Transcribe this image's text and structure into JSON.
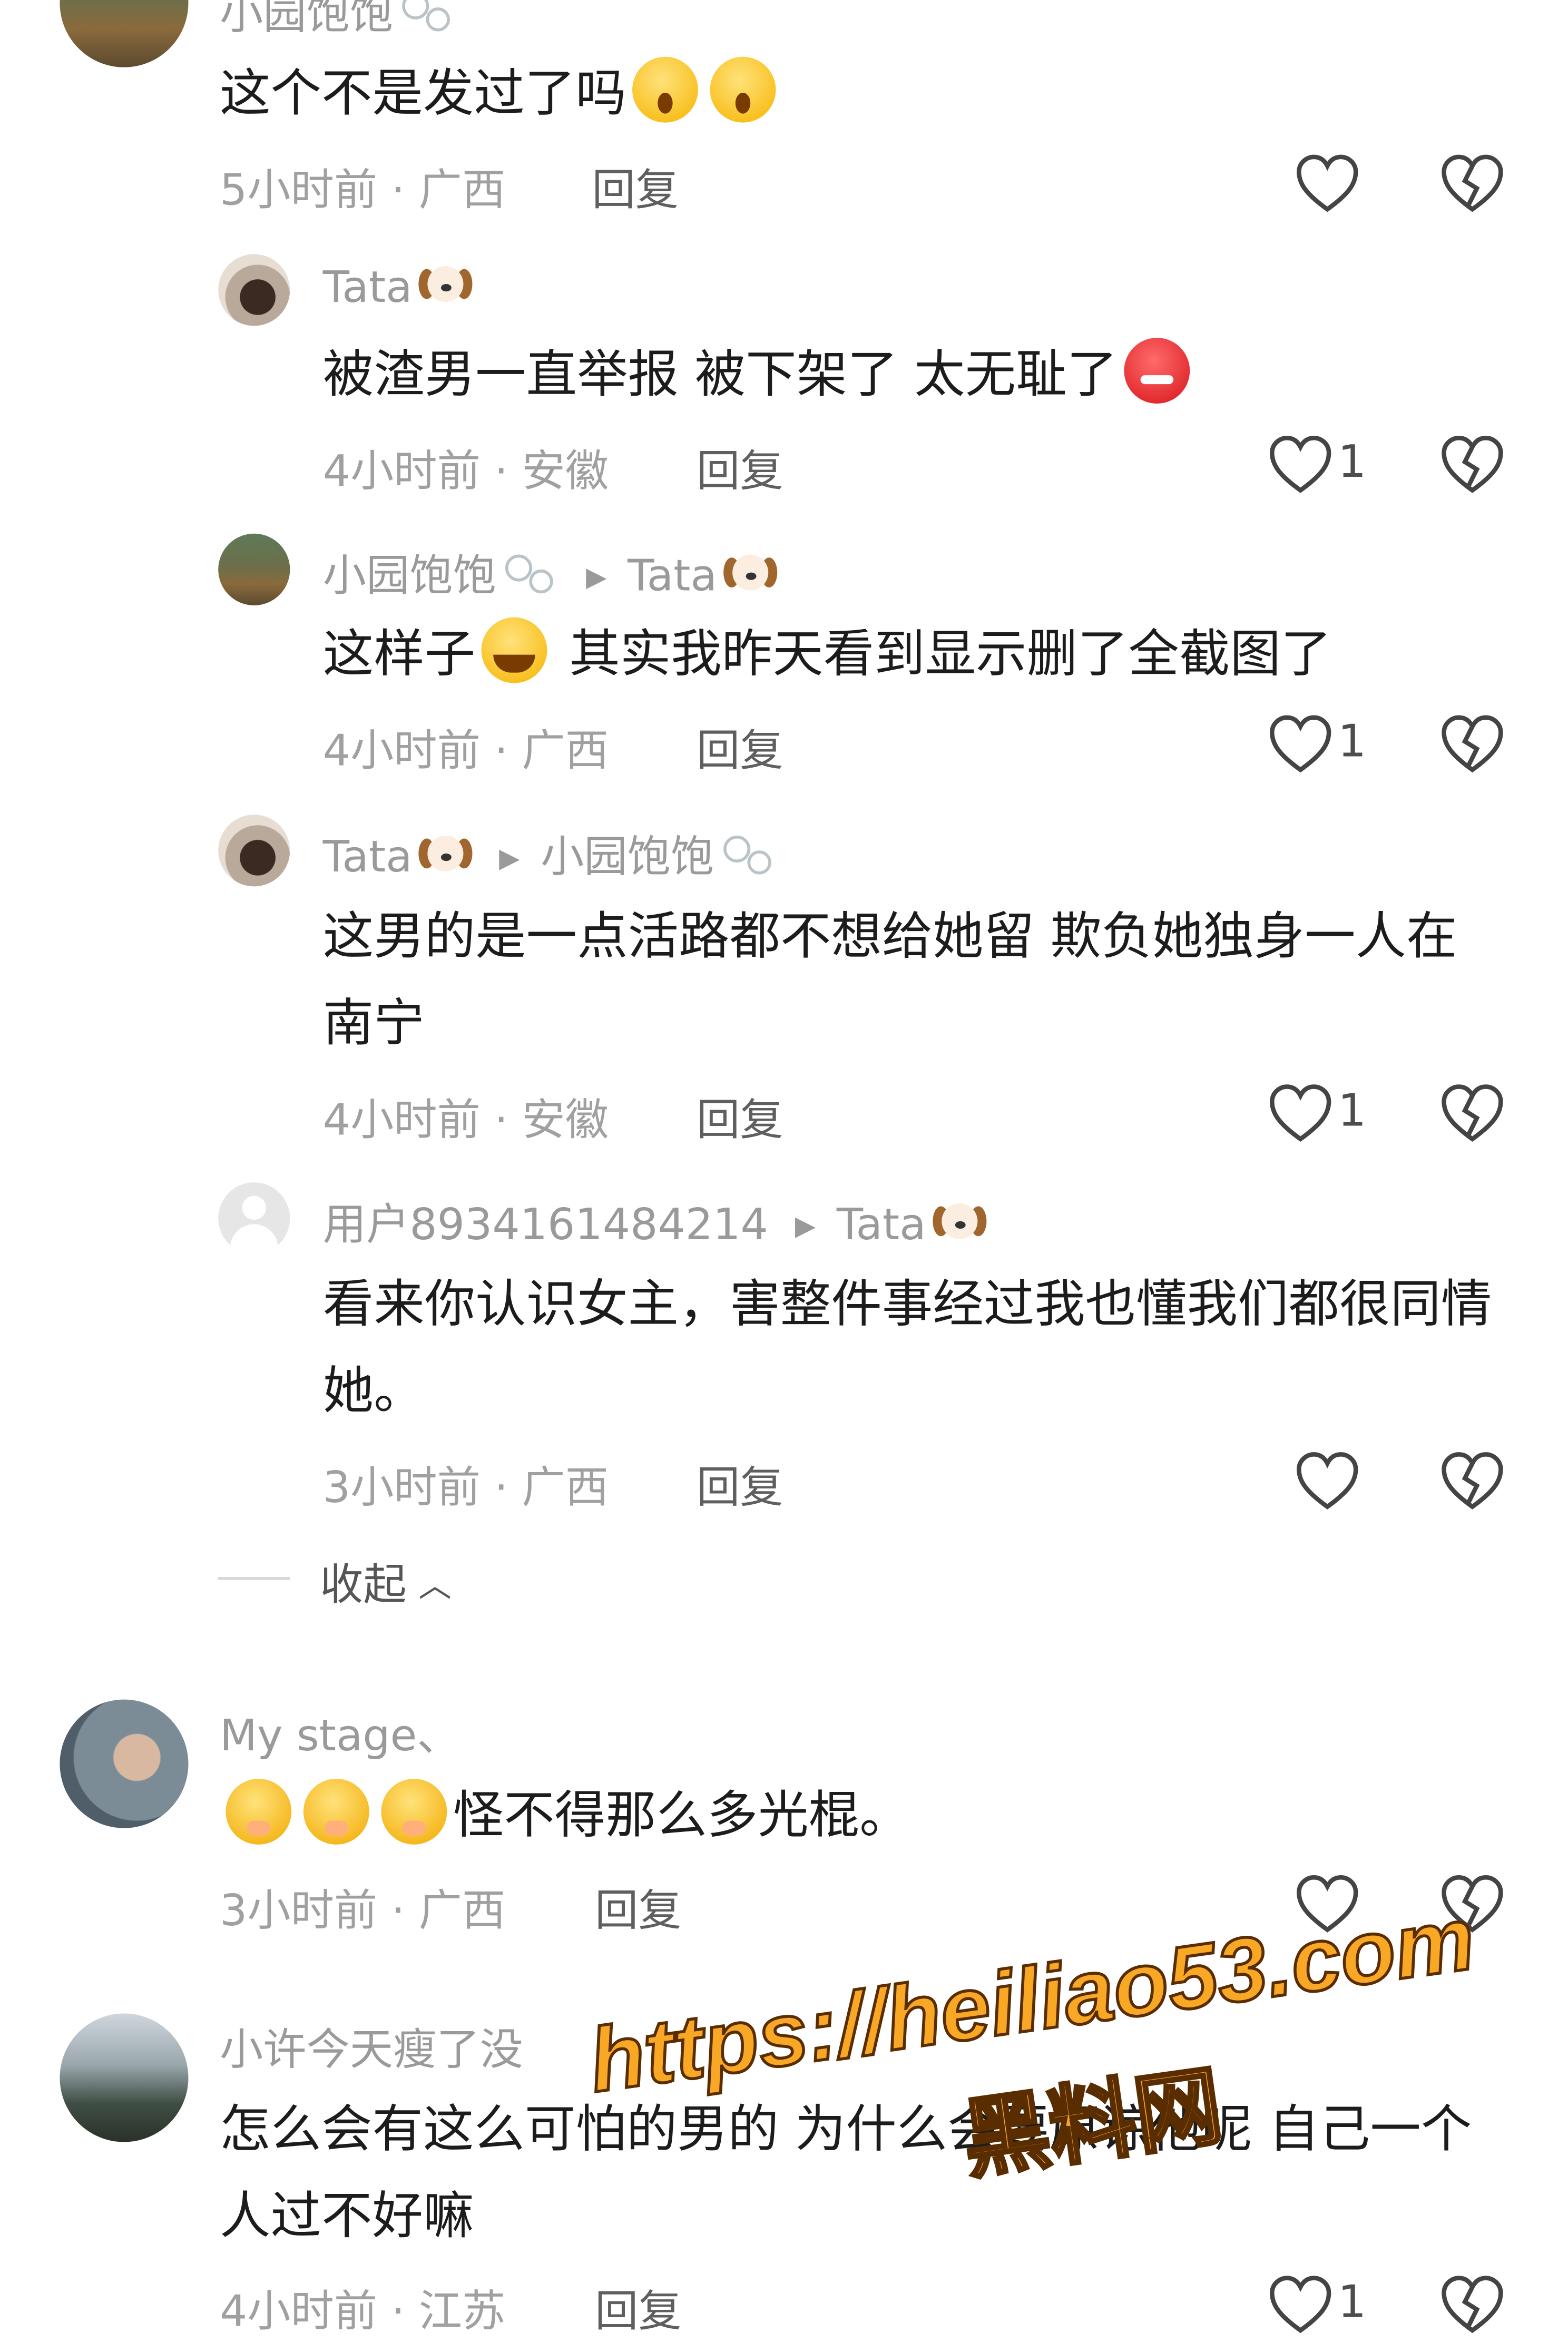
{
  "comments": [
    {
      "user": "小园饱饱",
      "text": "这个不是发过了吗",
      "time": "5小时前",
      "region": "广西",
      "reply": "回复"
    },
    {
      "user": "Tata",
      "text": "被渣男一直举报 被下架了 太无耻了",
      "time": "4小时前",
      "region": "安徽",
      "reply": "回复",
      "likes": "1"
    },
    {
      "user": "小园饱饱",
      "reply_to": "Tata",
      "text": "这样子",
      "text2": "其实我昨天看到显示删了全截图了",
      "time": "4小时前",
      "region": "广西",
      "reply": "回复",
      "likes": "1"
    },
    {
      "user": "Tata",
      "reply_to": "小园饱饱",
      "text": "这男的是一点活路都不想给她留 欺负她独身一人在南宁",
      "time": "4小时前",
      "region": "安徽",
      "reply": "回复",
      "likes": "1"
    },
    {
      "user": "用户8934161484214",
      "reply_to": "Tata",
      "text": "看来你认识女主，害整件事经过我也懂我们都很同情她。",
      "time": "3小时前",
      "region": "广西",
      "reply": "回复"
    },
    {
      "user": "My  stage、",
      "text": "怪不得那么多光棍。",
      "time": "3小时前",
      "region": "广西",
      "reply": "回复"
    },
    {
      "user": "小许今天瘦了没",
      "text": "怎么会有这么可怕的男的 为什么会要原谅他呢 自己一个人过不好嘛",
      "time": "4小时前",
      "region": "江苏",
      "reply": "回复",
      "likes": "1"
    }
  ],
  "collapse_label": "收起",
  "watermark": {
    "url": "https://heiliao53.com",
    "name": "黑料网"
  },
  "icons": {
    "like": "heart-outline-icon",
    "dislike": "broken-heart-icon",
    "collapse": "chevron-up-icon"
  },
  "colors": {
    "meta": "#a0a0a0",
    "name": "#9a9a9a",
    "watermark": "#f9a825"
  }
}
